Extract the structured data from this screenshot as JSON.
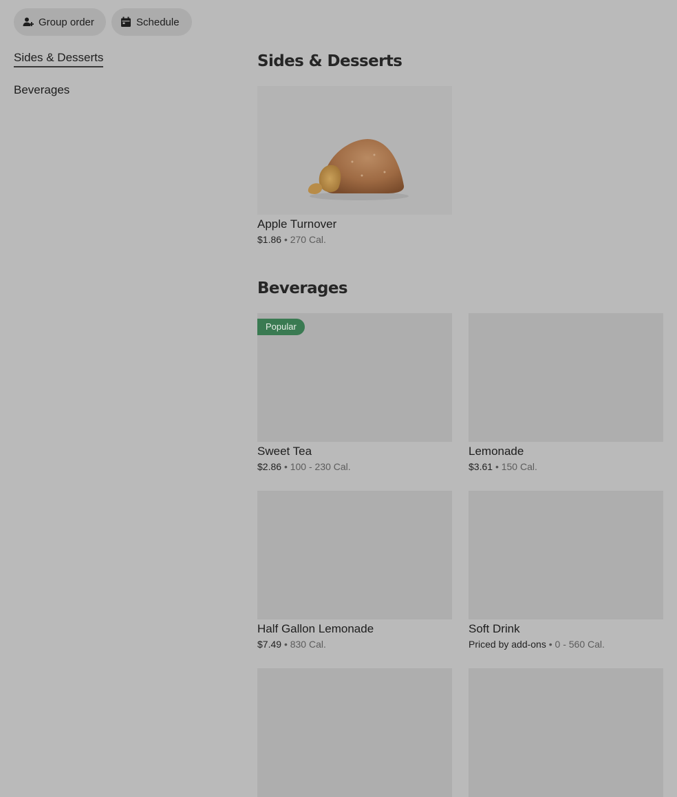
{
  "toolbar": {
    "group_order": "Group order",
    "schedule": "Schedule"
  },
  "sidebar": {
    "items": [
      {
        "label": "Sides & Desserts",
        "active": true
      },
      {
        "label": "Beverages",
        "active": false
      }
    ]
  },
  "sections": {
    "sides": {
      "title": "Sides & Desserts",
      "items": [
        {
          "name": "Apple Turnover",
          "price": "$1.86",
          "separator": "•",
          "calories": "270 Cal."
        }
      ]
    },
    "beverages": {
      "title": "Beverages",
      "badge": "Popular",
      "items": [
        {
          "name": "Sweet Tea",
          "price": "$2.86",
          "separator": "•",
          "calories": "100 - 230 Cal."
        },
        {
          "name": "Lemonade",
          "price": "$3.61",
          "separator": "•",
          "calories": "150 Cal."
        },
        {
          "name": "Half Gallon Lemonade",
          "price": "$7.49",
          "separator": "•",
          "calories": "830 Cal."
        },
        {
          "name": "Soft Drink",
          "price": "Priced by add-ons",
          "separator": "•",
          "calories": "0 - 560 Cal."
        }
      ]
    }
  },
  "icons": {
    "group_order": "person-add-icon",
    "schedule": "calendar-icon"
  },
  "colors": {
    "background": "#bababa",
    "pill": "#acacac",
    "badge": "#3a7a52",
    "placeholder": "#aeaeae"
  }
}
